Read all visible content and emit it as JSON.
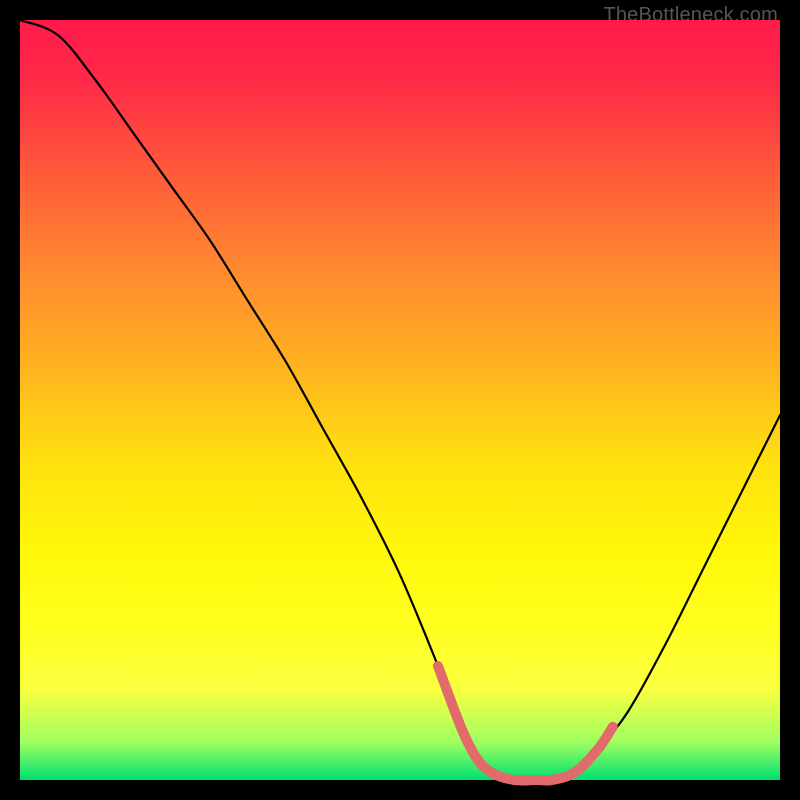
{
  "watermark": "TheBottleneck.com",
  "chart_data": {
    "type": "line",
    "title": "",
    "xlabel": "",
    "ylabel": "",
    "xlim": [
      0,
      100
    ],
    "ylim": [
      0,
      100
    ],
    "grid": false,
    "legend": false,
    "series": [
      {
        "name": "bottleneck-curve",
        "color": "#000000",
        "x": [
          0,
          5,
          10,
          15,
          20,
          25,
          30,
          35,
          40,
          45,
          50,
          55,
          58,
          60,
          62,
          65,
          68,
          70,
          73,
          76,
          80,
          85,
          90,
          95,
          100
        ],
        "y": [
          100,
          98,
          92,
          85,
          78,
          71,
          63,
          55,
          46,
          37,
          27,
          15,
          7,
          3,
          1,
          0,
          0,
          0,
          1,
          4,
          9,
          18,
          28,
          38,
          48
        ]
      },
      {
        "name": "optimal-segment",
        "color": "#e36a6a",
        "x": [
          55,
          58,
          60,
          62,
          65,
          68,
          70,
          73,
          76,
          78
        ],
        "y": [
          15,
          7,
          3,
          1,
          0,
          0,
          0,
          1,
          4,
          7
        ]
      }
    ]
  }
}
